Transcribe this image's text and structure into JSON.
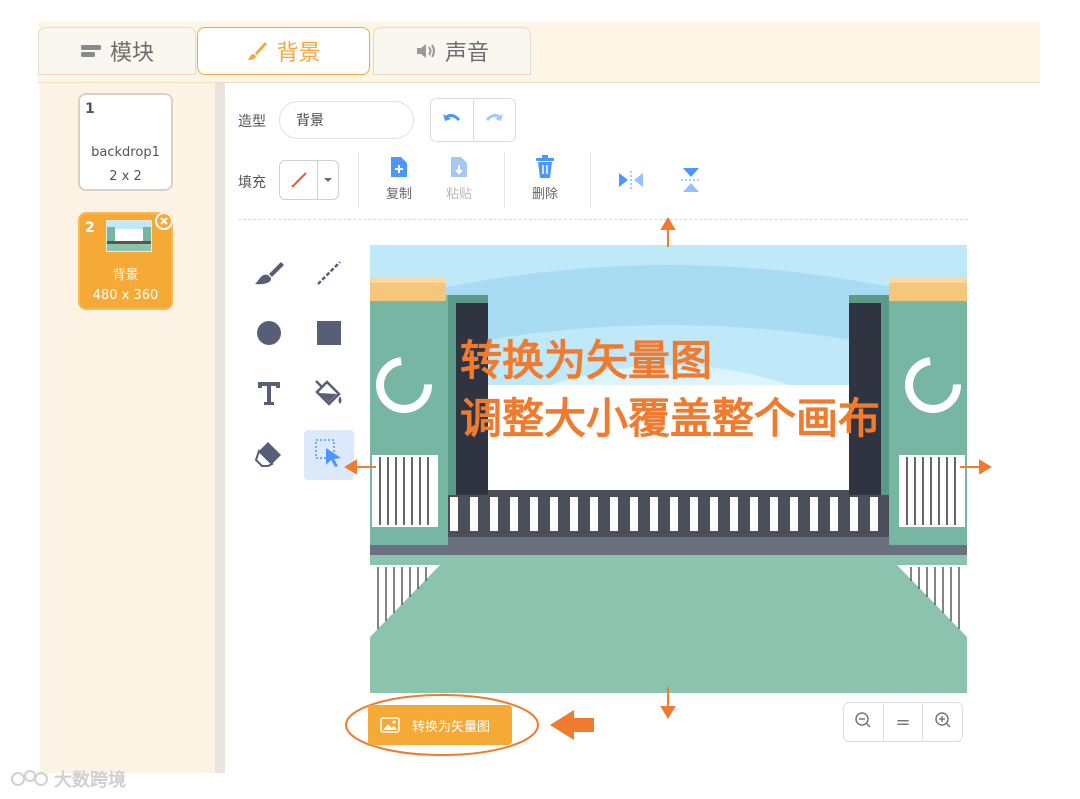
{
  "tabs": [
    {
      "label": "模块",
      "icon": "code-blocks-icon"
    },
    {
      "label": "背景",
      "icon": "paintbrush-icon"
    },
    {
      "label": "声音",
      "icon": "speaker-icon"
    }
  ],
  "backdrops": [
    {
      "number": "1",
      "name": "backdrop1",
      "size": "2 x 2"
    },
    {
      "number": "2",
      "name": "背景",
      "size": "480 x 360"
    }
  ],
  "editor": {
    "costume_label": "造型",
    "costume_name": "背景",
    "fill_label": "填充",
    "copy_label": "复制",
    "paste_label": "粘贴",
    "delete_label": "删除"
  },
  "annotation": {
    "line1": "转换为矢量图",
    "line2": "调整大小覆盖整个画布"
  },
  "bottom": {
    "convert_label": "转换为矢量图",
    "zoom_reset": "="
  },
  "watermark": "大数跨境",
  "colors": {
    "accent": "#f5a936",
    "annotation": "#f07a2e",
    "select_blue": "#4c97ff"
  }
}
